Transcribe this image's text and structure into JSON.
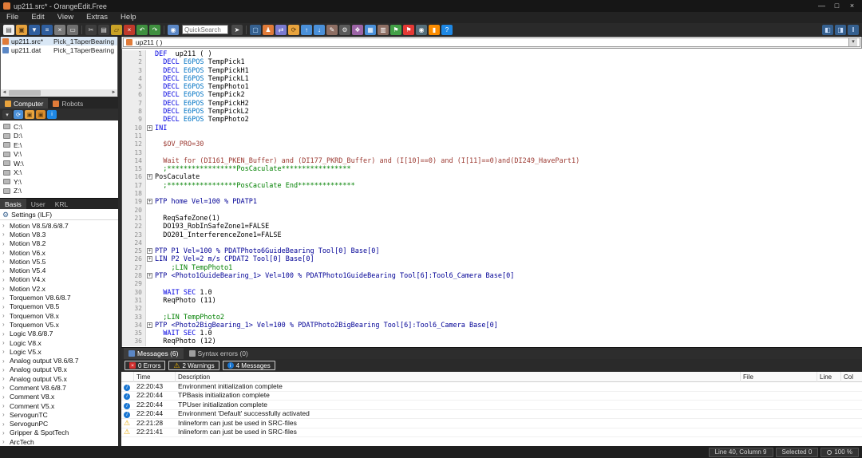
{
  "window": {
    "title": "up211.src* - OrangeEdit.Free",
    "minimize": "—",
    "maximize": "□",
    "close": "×"
  },
  "menu": {
    "items": [
      "File",
      "Edit",
      "View",
      "Extras",
      "Help"
    ]
  },
  "toolbar": {
    "quicksearch_placeholder": "QuickSearch",
    "icons": [
      {
        "n": "new-file-icon",
        "g": "▤",
        "fg": "#444444",
        "bg": "#f0f0f0"
      },
      {
        "n": "open-file-icon",
        "g": "▣",
        "fg": "#5a3a10",
        "bg": "#e8a33d"
      },
      {
        "n": "save-icon",
        "g": "▼",
        "fg": "#ffffff",
        "bg": "#2f5e9e"
      },
      {
        "n": "save-all-icon",
        "g": "≡",
        "fg": "#ffffff",
        "bg": "#2f5e9e"
      },
      {
        "n": "close-file-icon",
        "g": "×",
        "fg": "#ffffff",
        "bg": "#7a7a7a"
      },
      {
        "n": "print-icon",
        "g": "▭",
        "fg": "#ffffff",
        "bg": "#6f6f6f"
      },
      {
        "sep": true
      },
      {
        "n": "cut-icon",
        "g": "✂",
        "fg": "#e0e0e0",
        "bg": "#3d3d3d"
      },
      {
        "n": "copy-icon",
        "g": "▤",
        "fg": "#e0e0e0",
        "bg": "#3d3d3d"
      },
      {
        "n": "paste-icon",
        "g": "▱",
        "fg": "#4a3208",
        "bg": "#c9a227"
      },
      {
        "n": "delete-icon",
        "g": "×",
        "fg": "#ffffff",
        "bg": "#c0392b"
      },
      {
        "n": "undo-icon",
        "g": "↶",
        "fg": "#ffffff",
        "bg": "#3f8f3f"
      },
      {
        "n": "redo-icon",
        "g": "↷",
        "fg": "#ffffff",
        "bg": "#3f8f3f"
      },
      {
        "sep": true
      },
      {
        "n": "find-icon",
        "g": "◉",
        "fg": "#ffffff",
        "bg": "#5b87c5"
      },
      {
        "qs": true
      },
      {
        "n": "search-go-icon",
        "g": "➤",
        "fg": "#ffffff",
        "bg": "#4a4a4a"
      },
      {
        "sep": true
      },
      {
        "n": "monitor-icon",
        "g": "▢",
        "fg": "#bfe0ff",
        "bg": "#35608f"
      },
      {
        "n": "robot-icon",
        "g": "♟",
        "fg": "#ffffff",
        "bg": "#e07b39"
      },
      {
        "n": "compare-files-icon",
        "g": "⇄",
        "fg": "#ffffff",
        "bg": "#7a7ad0"
      },
      {
        "n": "sync-folder-icon",
        "g": "⟳",
        "fg": "#5a3a10",
        "bg": "#e8a33d"
      },
      {
        "n": "upload-icon",
        "g": "↑",
        "fg": "#ffffff",
        "bg": "#4a90d9"
      },
      {
        "n": "download-icon",
        "g": "↓",
        "fg": "#ffffff",
        "bg": "#4a90d9"
      },
      {
        "n": "edit-icon",
        "g": "✎",
        "fg": "#ffffff",
        "bg": "#8d6e63"
      },
      {
        "n": "settings-gear-icon",
        "g": "⚙",
        "fg": "#f0f0f0",
        "bg": "#5a5a5a"
      },
      {
        "n": "plugin-icon",
        "g": "❖",
        "fg": "#ffffff",
        "bg": "#9c64a6"
      },
      {
        "n": "grid-view-icon",
        "g": "▦",
        "fg": "#ffffff",
        "bg": "#4a90d9"
      },
      {
        "n": "manual-icon",
        "g": "▥",
        "fg": "#ffffff",
        "bg": "#8d6e63"
      },
      {
        "n": "flag-green-icon",
        "g": "⚑",
        "fg": "#ffffff",
        "bg": "#43a047"
      },
      {
        "n": "flag-red-icon",
        "g": "⚑",
        "fg": "#ffffff",
        "bg": "#e53935"
      },
      {
        "n": "camera-icon",
        "g": "◉",
        "fg": "#ffffff",
        "bg": "#546e7a"
      },
      {
        "n": "chart-icon",
        "g": "▮",
        "fg": "#ffffff",
        "bg": "#fb8c00"
      },
      {
        "n": "help-icon",
        "g": "?",
        "fg": "#ffffff",
        "bg": "#1e88e5"
      }
    ],
    "right_icons": [
      {
        "n": "split-left-icon",
        "g": "◧",
        "fg": "#cfe2ff",
        "bg": "#35608f"
      },
      {
        "n": "split-right-icon",
        "g": "◨",
        "fg": "#cfe2ff",
        "bg": "#35608f"
      },
      {
        "n": "pause-layout-icon",
        "g": "‖",
        "fg": "#cfe2ff",
        "bg": "#35608f"
      }
    ]
  },
  "file_panel": {
    "files": [
      {
        "name": "up211.src*",
        "desc": "Pick_1TaperBearing",
        "color": "#e07b39",
        "selected": true
      },
      {
        "name": "up211.dat",
        "desc": "Pick_1TaperBearing",
        "color": "#5b87c5",
        "selected": false
      }
    ]
  },
  "explorer": {
    "tabs": [
      {
        "label": "Computer",
        "active": true,
        "icon_color": "#e8a33d"
      },
      {
        "label": "Robots",
        "active": false,
        "icon_color": "#e07b39"
      }
    ],
    "mini_icons": [
      {
        "n": "path-dropdown",
        "g": "▾",
        "fg": "#d0d0d0",
        "bg": "#3a3a3a"
      },
      {
        "n": "refresh-icon",
        "g": "⟳",
        "fg": "#ffffff",
        "bg": "#4a90d9"
      },
      {
        "n": "folder-up-icon",
        "g": "▣",
        "fg": "#5a3a10",
        "bg": "#e8a33d"
      },
      {
        "n": "new-folder-icon",
        "g": "▣",
        "fg": "#5a3a10",
        "bg": "#d98c2b"
      },
      {
        "n": "info-icon",
        "g": "i",
        "fg": "#ffffff",
        "bg": "#1e88e5"
      }
    ],
    "drives": [
      "C:\\",
      "D:\\",
      "E:\\",
      "V:\\",
      "W:\\",
      "X:\\",
      "Y:\\",
      "Z:\\"
    ]
  },
  "ilf": {
    "tabs": [
      {
        "label": "Basis",
        "active": true
      },
      {
        "label": "User",
        "active": false
      },
      {
        "label": "KRL",
        "active": false
      }
    ],
    "header": "Settings (ILF)",
    "items": [
      "Motion V8.5/8.6/8.7",
      "Motion V8.3",
      "Motion V8.2",
      "Motion V6.x",
      "Motion V5.5",
      "Motion V5.4",
      "Motion V4.x",
      "Motion V2.x",
      "Torquemon V8.6/8.7",
      "Torquemon V8.5",
      "Torquemon V8.x",
      "Torquemon V5.x",
      "Logic V8.6/8.7",
      "Logic V8.x",
      "Logic V5.x",
      "Analog output V8.6/8.7",
      "Analog output V8.x",
      "Analog output V5.x",
      "Comment V8.6/8.7",
      "Comment V8.x",
      "Comment V5.x",
      "ServogunTC",
      "ServogunPC",
      "Gripper & SpotTech",
      "ArcTech"
    ]
  },
  "editor": {
    "doc_tab": "up211 ( )",
    "lines": [
      {
        "n": 1,
        "seg": [
          [
            "kw",
            "DEF"
          ],
          [
            "pl",
            "  up211 ( )"
          ]
        ]
      },
      {
        "n": 2,
        "seg": [
          [
            "pl",
            "  "
          ],
          [
            "kw",
            "DECL"
          ],
          [
            "pl",
            " "
          ],
          [
            "ty",
            "E6POS"
          ],
          [
            "pl",
            " TempPick1"
          ]
        ]
      },
      {
        "n": 3,
        "seg": [
          [
            "pl",
            "  "
          ],
          [
            "kw",
            "DECL"
          ],
          [
            "pl",
            " "
          ],
          [
            "ty",
            "E6POS"
          ],
          [
            "pl",
            " TempPickH1"
          ]
        ]
      },
      {
        "n": 4,
        "seg": [
          [
            "pl",
            "  "
          ],
          [
            "kw",
            "DECL"
          ],
          [
            "pl",
            " "
          ],
          [
            "ty",
            "E6POS"
          ],
          [
            "pl",
            " TempPickL1"
          ]
        ]
      },
      {
        "n": 5,
        "seg": [
          [
            "pl",
            "  "
          ],
          [
            "kw",
            "DECL"
          ],
          [
            "pl",
            " "
          ],
          [
            "ty",
            "E6POS"
          ],
          [
            "pl",
            " TempPhoto1"
          ]
        ]
      },
      {
        "n": 6,
        "seg": [
          [
            "pl",
            "  "
          ],
          [
            "kw",
            "DECL"
          ],
          [
            "pl",
            " "
          ],
          [
            "ty",
            "E6POS"
          ],
          [
            "pl",
            " TempPick2"
          ]
        ]
      },
      {
        "n": 7,
        "seg": [
          [
            "pl",
            "  "
          ],
          [
            "kw",
            "DECL"
          ],
          [
            "pl",
            " "
          ],
          [
            "ty",
            "E6POS"
          ],
          [
            "pl",
            " TempPickH2"
          ]
        ]
      },
      {
        "n": 8,
        "seg": [
          [
            "pl",
            "  "
          ],
          [
            "kw",
            "DECL"
          ],
          [
            "pl",
            " "
          ],
          [
            "ty",
            "E6POS"
          ],
          [
            "pl",
            " TempPickL2"
          ]
        ]
      },
      {
        "n": 9,
        "seg": [
          [
            "pl",
            "  "
          ],
          [
            "kw",
            "DECL"
          ],
          [
            "pl",
            " "
          ],
          [
            "ty",
            "E6POS"
          ],
          [
            "pl",
            " TempPhoto2"
          ]
        ]
      },
      {
        "n": 10,
        "fold": 1,
        "seg": [
          [
            "kw",
            "INI"
          ]
        ]
      },
      {
        "n": 11,
        "seg": []
      },
      {
        "n": 12,
        "seg": [
          [
            "pl",
            "  "
          ],
          [
            "rd",
            "$OV_PRO=30"
          ]
        ]
      },
      {
        "n": 13,
        "seg": []
      },
      {
        "n": 14,
        "seg": [
          [
            "pl",
            "  "
          ],
          [
            "rd",
            "Wait for (DI161_PKEN_Buffer) and (DI177_PKRD_Buffer) and (I[10]==0) and (I[11]==0)and(DI249_HavePart1)"
          ]
        ]
      },
      {
        "n": 15,
        "seg": [
          [
            "pl",
            "  "
          ],
          [
            "cm",
            ";*****************PosCaculate*****************"
          ]
        ]
      },
      {
        "n": 16,
        "fold": 1,
        "seg": [
          [
            "pl",
            "PosCaculate"
          ]
        ]
      },
      {
        "n": 17,
        "seg": [
          [
            "pl",
            "  "
          ],
          [
            "cm",
            ";*****************PosCaculate End**************"
          ]
        ]
      },
      {
        "n": 18,
        "seg": []
      },
      {
        "n": 19,
        "fold": 1,
        "seg": [
          [
            "ilf",
            "PTP home Vel=100 % PDATP1"
          ]
        ]
      },
      {
        "n": 20,
        "seg": []
      },
      {
        "n": 21,
        "seg": [
          [
            "pl",
            "  ReqSafeZone(1)"
          ]
        ]
      },
      {
        "n": 22,
        "seg": [
          [
            "pl",
            "  DO193_RobInSafeZone1=FALSE"
          ]
        ]
      },
      {
        "n": 23,
        "seg": [
          [
            "pl",
            "  DO201_InterferenceZone1=FALSE"
          ]
        ]
      },
      {
        "n": 24,
        "seg": []
      },
      {
        "n": 25,
        "fold": 1,
        "seg": [
          [
            "ilf",
            "PTP P1 Vel=100 % PDATPhoto6GuideBearing Tool[0] Base[0]"
          ]
        ]
      },
      {
        "n": 26,
        "fold": 1,
        "seg": [
          [
            "ilf",
            "LIN P2 Vel=2 m/s CPDAT2 Tool[0] Base[0]"
          ]
        ]
      },
      {
        "n": 27,
        "seg": [
          [
            "pl",
            "    "
          ],
          [
            "cm",
            ";LIN TempPhoto1"
          ]
        ]
      },
      {
        "n": 28,
        "fold": 1,
        "seg": [
          [
            "ilf",
            "PTP <Photo1GuideBearing_1> Vel=100 % PDATPhoto1GuideBearing Tool[6]:Tool6_Camera Base[0]"
          ]
        ]
      },
      {
        "n": 29,
        "seg": []
      },
      {
        "n": 30,
        "seg": [
          [
            "pl",
            "  "
          ],
          [
            "kw",
            "WAIT SEC"
          ],
          [
            "pl",
            " 1.0"
          ]
        ]
      },
      {
        "n": 31,
        "seg": [
          [
            "pl",
            "  ReqPhoto (11)"
          ]
        ]
      },
      {
        "n": 32,
        "seg": []
      },
      {
        "n": 33,
        "seg": [
          [
            "pl",
            "  "
          ],
          [
            "cm",
            ";LIN TempPhoto2"
          ]
        ]
      },
      {
        "n": 34,
        "fold": 1,
        "seg": [
          [
            "ilf",
            "PTP <Photo2BigBearing_1> Vel=100 % PDATPhoto2BigBearing Tool[6]:Tool6_Camera Base[0]"
          ]
        ]
      },
      {
        "n": 35,
        "seg": [
          [
            "pl",
            "  "
          ],
          [
            "kw",
            "WAIT SEC"
          ],
          [
            "pl",
            " 1.0"
          ]
        ]
      },
      {
        "n": 36,
        "seg": [
          [
            "pl",
            "  ReqPhoto (12)"
          ]
        ]
      }
    ]
  },
  "messages": {
    "tabs": [
      {
        "label": "Messages (6)",
        "active": true,
        "icon_color": "#5b87c5"
      },
      {
        "label": "Syntax errors (0)",
        "active": false,
        "icon_color": "#9e9e9e"
      }
    ],
    "filters": [
      {
        "label": "0 Errors",
        "kind": "error"
      },
      {
        "label": "2 Warnings",
        "kind": "warning"
      },
      {
        "label": "4 Messages",
        "kind": "info"
      }
    ],
    "columns": [
      "Time",
      "Description",
      "File",
      "Line",
      "Col"
    ],
    "rows": [
      {
        "icon": "info",
        "time": "22:20:43",
        "desc": "Environment initialization complete",
        "file": "",
        "line": "",
        "col": ""
      },
      {
        "icon": "info",
        "time": "22:20:44",
        "desc": "TPBasis initialization complete",
        "file": "",
        "line": "",
        "col": ""
      },
      {
        "icon": "info",
        "time": "22:20:44",
        "desc": "TPUser initialization complete",
        "file": "",
        "line": "",
        "col": ""
      },
      {
        "icon": "info",
        "time": "22:20:44",
        "desc": "Environment 'Default' successfully activated",
        "file": "",
        "line": "",
        "col": ""
      },
      {
        "icon": "warning",
        "time": "22:21:28",
        "desc": "Inlineform can just be used in SRC-files",
        "file": "",
        "line": "",
        "col": ""
      },
      {
        "icon": "warning",
        "time": "22:21:41",
        "desc": "Inlineform can just be used in SRC-files",
        "file": "",
        "line": "",
        "col": ""
      }
    ]
  },
  "status": {
    "line_col": "Line 40, Column 9",
    "selected": "Selected 0",
    "zoom": "100 %"
  }
}
